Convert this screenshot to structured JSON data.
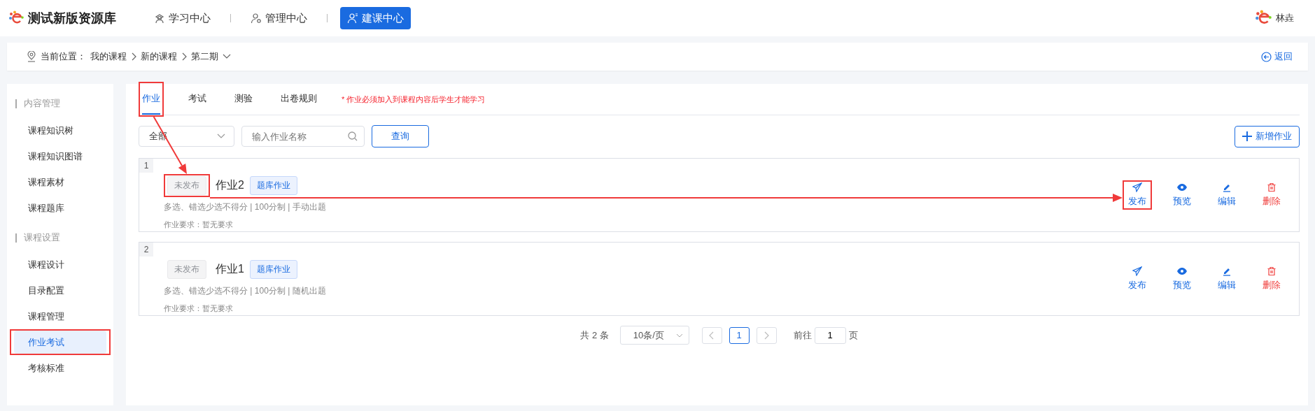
{
  "header": {
    "app_title": "测试新版资源库",
    "nav": [
      {
        "label": "学习中心",
        "kind": "learn",
        "selected": false
      },
      {
        "label": "管理中心",
        "kind": "manage",
        "selected": false
      },
      {
        "label": "建课中心",
        "kind": "build",
        "selected": true
      }
    ],
    "user": "林垚"
  },
  "breadcrumb": {
    "prefix": "当前位置：",
    "crumbs": [
      "我的课程",
      "新的课程",
      "第二期"
    ],
    "back": "返回"
  },
  "sidebar": [
    {
      "title": "内容管理",
      "items": [
        {
          "label": "课程知识树",
          "selected": false,
          "highlighted": false
        },
        {
          "label": "课程知识图谱",
          "selected": false,
          "highlighted": false
        },
        {
          "label": "课程素材",
          "selected": false,
          "highlighted": false
        },
        {
          "label": "课程题库",
          "selected": false,
          "highlighted": false
        }
      ]
    },
    {
      "title": "课程设置",
      "items": [
        {
          "label": "课程设计",
          "selected": false,
          "highlighted": false
        },
        {
          "label": "目录配置",
          "selected": false,
          "highlighted": false
        },
        {
          "label": "课程管理",
          "selected": false,
          "highlighted": false
        },
        {
          "label": "作业考试",
          "selected": true,
          "highlighted": true
        },
        {
          "label": "考核标准",
          "selected": false,
          "highlighted": false
        }
      ]
    }
  ],
  "tabs": [
    {
      "label": "作业",
      "selected": true,
      "highlighted": true,
      "arrow_chain": true
    },
    {
      "label": "考试",
      "selected": false,
      "highlighted": false
    },
    {
      "label": "测验",
      "selected": false,
      "highlighted": false
    },
    {
      "label": "出卷规则",
      "selected": false,
      "highlighted": false
    }
  ],
  "tab_note": "* 作业必须加入到课程内容后学生才能学习",
  "filter": {
    "select": "全部",
    "search_placeholder": "输入作业名称",
    "query_button": "查询",
    "add_button": "新增作业"
  },
  "assignments": [
    {
      "index": "1",
      "status": "未发布",
      "status_highlighted": true,
      "status_arrow_chain": true,
      "title": "作业2",
      "type": "题库作业",
      "meta": "多选、错选少选不得分 | 100分制 | 手动出题",
      "requirement": "作业要求：暂无要求",
      "actions": [
        {
          "label": "发布",
          "kind": "publish",
          "highlighted": true,
          "arrow_chain": true
        },
        {
          "label": "预览",
          "kind": "preview",
          "highlighted": false
        },
        {
          "label": "编辑",
          "kind": "edit",
          "highlighted": false
        },
        {
          "label": "删除",
          "kind": "delete",
          "highlighted": false
        }
      ]
    },
    {
      "index": "2",
      "status": "未发布",
      "status_highlighted": false,
      "title": "作业1",
      "type": "题库作业",
      "meta": "多选、错选少选不得分 | 100分制 | 随机出题",
      "requirement": "作业要求：暂无要求",
      "actions": [
        {
          "label": "发布",
          "kind": "publish",
          "highlighted": false
        },
        {
          "label": "预览",
          "kind": "preview",
          "highlighted": false
        },
        {
          "label": "编辑",
          "kind": "edit",
          "highlighted": false
        },
        {
          "label": "删除",
          "kind": "delete",
          "highlighted": false
        }
      ]
    }
  ],
  "pagination": {
    "total": "共 2 条",
    "page_size": "10条/页",
    "pages": [
      {
        "label": "1",
        "selected": true
      }
    ],
    "goto_label": "前往",
    "goto_value": "1",
    "goto_suffix": "页"
  }
}
